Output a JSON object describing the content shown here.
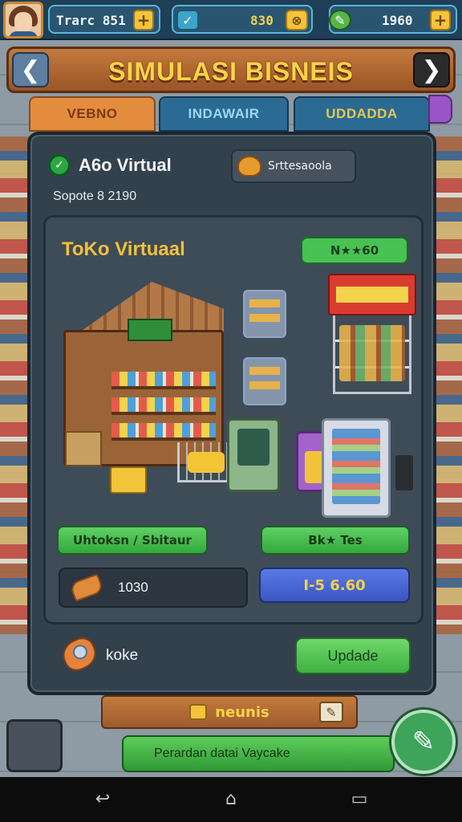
{
  "hud": {
    "player_name": "Trarc 851",
    "cash": "830",
    "gems": "1960",
    "plus_glyph": "+"
  },
  "header": {
    "title": "SIMULASI BISNEIS",
    "back_glyph": "❮",
    "forward_glyph": "❯"
  },
  "tabs": [
    {
      "label": "VEBNO"
    },
    {
      "label": "INDAWAIR"
    },
    {
      "label": "UDDADDA"
    }
  ],
  "store_card": {
    "name": "A6o Virtual",
    "tag": "Srttesaoola",
    "date": "Sopote 8 2190",
    "inner_title": "ToKo Virtuaal",
    "rating_label": "N★★60",
    "left_button": "Uhtoksn / Sbitaur",
    "right_button": "Bk★ Tes",
    "stat_value": "1030",
    "price_label": "I-5 6.60"
  },
  "footer": {
    "label": "koke",
    "update_button": "Updade"
  },
  "lower_bar": {
    "label": "neunis"
  },
  "bottom_button": {
    "label": "Perardan datai Vaycake"
  },
  "system_nav": {
    "back": "↩",
    "home": "⌂",
    "recents": "▭"
  },
  "colors": {
    "accent_gold": "#f8d44a",
    "hud_blue": "#1e3f57",
    "panel_dark": "#33414d",
    "button_green": "#48c253",
    "button_blue": "#3a56c2"
  }
}
